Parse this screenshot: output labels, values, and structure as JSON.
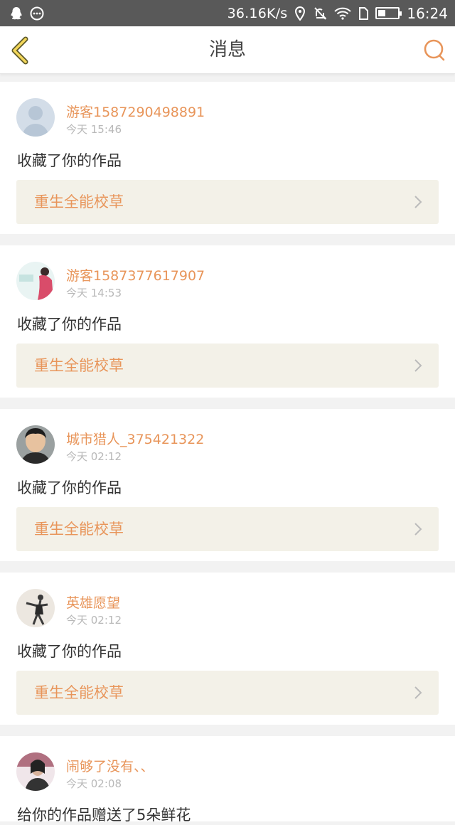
{
  "status_bar": {
    "speed": "36.16K/s",
    "time": "16:24",
    "icons": [
      "qq-icon",
      "message-icon",
      "location-icon",
      "mute-icon",
      "wifi-icon",
      "sim-icon",
      "battery-icon"
    ]
  },
  "header": {
    "title": "消息",
    "back_icon": "chevron-left-icon",
    "search_icon": "search-icon",
    "accent_color": "#e8955a"
  },
  "messages": [
    {
      "user": "游客1587290498891",
      "time": "今天 15:46",
      "action": "收藏了你的作品",
      "work": "重生全能校草"
    },
    {
      "user": "游客1587377617907",
      "time": "今天 14:53",
      "action": "收藏了你的作品",
      "work": "重生全能校草"
    },
    {
      "user": "城市猎人_375421322",
      "time": "今天 02:12",
      "action": "收藏了你的作品",
      "work": "重生全能校草"
    },
    {
      "user": "英雄愿望",
      "time": "今天 02:12",
      "action": "收藏了你的作品",
      "work": "重生全能校草"
    },
    {
      "user": "闹够了没有、、",
      "time": "今天 02:08",
      "action": "给你的作品赠送了5朵鲜花"
    }
  ]
}
